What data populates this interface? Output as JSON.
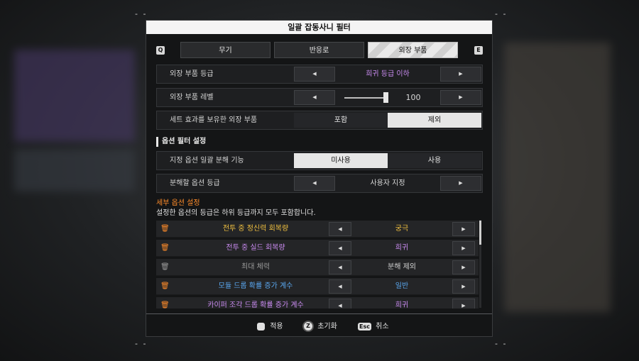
{
  "dialog": {
    "title": "일괄 잡동사니 필터"
  },
  "tabs": {
    "prev_key": "Q",
    "next_key": "E",
    "items": [
      {
        "label": "무기",
        "active": false
      },
      {
        "label": "반응로",
        "active": false
      },
      {
        "label": "외장 부품",
        "active": true
      }
    ]
  },
  "settings": {
    "grade": {
      "label": "외장 부품 등급",
      "value": "희귀 등급 이하"
    },
    "level": {
      "label": "외장 부품 레벨",
      "value": "100",
      "slider_fraction": 1.0
    },
    "set_effect": {
      "label": "세트 효과를 보유한 외장 부품",
      "options": [
        "포함",
        "제외"
      ],
      "selected": "제외"
    }
  },
  "option_filter": {
    "section_title": "옵션 필터 설정",
    "bulk_dismantle": {
      "label": "지정 옵션 일괄 분해 기능",
      "options": [
        "미사용",
        "사용"
      ],
      "selected": "미사용"
    },
    "option_grade": {
      "label": "분해할 옵션 등급",
      "value": "사용자 지정"
    },
    "detail_title": "세부 옵션 설정",
    "detail_desc": "설정한 옵션의 등급은 하위 등급까지 모두 포함합니다.",
    "options": [
      {
        "name": "전투 중 정신력 회복량",
        "value": "궁극",
        "color": "#f0c040",
        "icon": "trash-icon"
      },
      {
        "name": "전투 중 실드 회복량",
        "value": "희귀",
        "color": "#c98bf0",
        "icon": "trash-icon"
      },
      {
        "name": "최대 체력",
        "value": "분해 제외",
        "color": "#a0a0a0",
        "icon": "trash-disabled-icon"
      },
      {
        "name": "모듈 드롭 확률 증가 계수",
        "value": "일반",
        "color": "#5aa8f0",
        "icon": "trash-icon"
      },
      {
        "name": "카이퍼 조각 드롭 확률 증가 계수",
        "value": "희귀",
        "color": "#c98bf0",
        "icon": "trash-icon"
      }
    ]
  },
  "footer": {
    "apply": {
      "key": "",
      "label": "적용"
    },
    "reset": {
      "key": "Z",
      "label": "초기화"
    },
    "cancel": {
      "key": "Esc",
      "label": "취소"
    }
  },
  "colors": {
    "accent_orange": "#ff8c2a",
    "rare_purple": "#c98bf0",
    "ultimate_gold": "#f0c040",
    "normal_blue": "#5aa8f0"
  }
}
